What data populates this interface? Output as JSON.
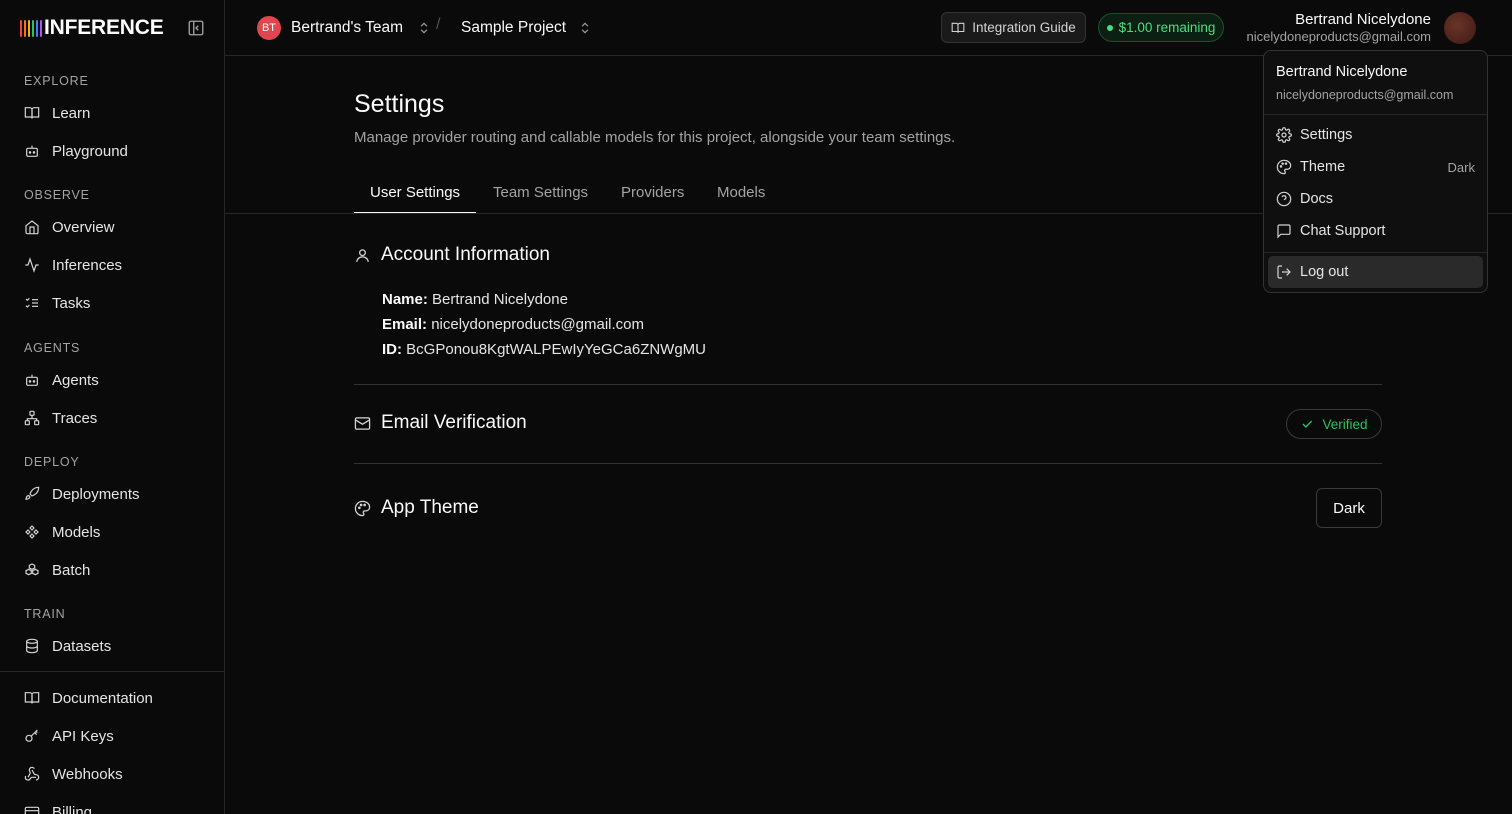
{
  "brand": {
    "name": "INFERENCE",
    "bar_colors": [
      "#ef4444",
      "#f97316",
      "#eab308",
      "#22c55e",
      "#3b82f6",
      "#a855f7"
    ]
  },
  "sidebar": {
    "sections": [
      {
        "label": "EXPLORE",
        "items": [
          {
            "label": "Learn",
            "icon": "book-icon"
          },
          {
            "label": "Playground",
            "icon": "bot-icon"
          }
        ]
      },
      {
        "label": "OBSERVE",
        "items": [
          {
            "label": "Overview",
            "icon": "home-icon"
          },
          {
            "label": "Inferences",
            "icon": "activity-icon"
          },
          {
            "label": "Tasks",
            "icon": "list-checks-icon"
          }
        ]
      },
      {
        "label": "AGENTS",
        "items": [
          {
            "label": "Agents",
            "icon": "bot-icon"
          },
          {
            "label": "Traces",
            "icon": "network-icon"
          }
        ]
      },
      {
        "label": "DEPLOY",
        "items": [
          {
            "label": "Deployments",
            "icon": "rocket-icon"
          },
          {
            "label": "Models",
            "icon": "diamond-nodes-icon"
          },
          {
            "label": "Batch",
            "icon": "boxes-icon"
          }
        ]
      },
      {
        "label": "TRAIN",
        "items": [
          {
            "label": "Datasets",
            "icon": "database-icon"
          }
        ]
      }
    ],
    "footer_items": [
      {
        "label": "Documentation",
        "icon": "book-icon"
      },
      {
        "label": "API Keys",
        "icon": "key-icon"
      },
      {
        "label": "Webhooks",
        "icon": "webhook-icon"
      },
      {
        "label": "Billing",
        "icon": "credit-card-icon"
      }
    ]
  },
  "topbar": {
    "team": {
      "initials": "BT",
      "name": "Bertrand's Team"
    },
    "separator": "/",
    "project": "Sample Project",
    "integration_label": "Integration Guide",
    "credit_label": "$1.00 remaining",
    "user": {
      "name": "Bertrand Nicelydone",
      "email": "nicelydoneproducts@gmail.com"
    }
  },
  "page": {
    "title": "Settings",
    "description": "Manage provider routing and callable models for this project, alongside your team settings.",
    "tabs": [
      "User Settings",
      "Team Settings",
      "Providers",
      "Models"
    ],
    "active_tab": "User Settings"
  },
  "account": {
    "title": "Account Information",
    "name_label": "Name:",
    "name": "Bertrand Nicelydone",
    "email_label": "Email:",
    "email": "nicelydoneproducts@gmail.com",
    "id_label": "ID:",
    "id": "BcGPonou8KgtWALPEwIyYeGCa6ZNWgMU"
  },
  "email_verification": {
    "title": "Email Verification",
    "status": "Verified"
  },
  "app_theme": {
    "title": "App Theme",
    "value": "Dark"
  },
  "dropdown": {
    "name": "Bertrand Nicelydone",
    "email": "nicelydoneproducts@gmail.com",
    "items": [
      {
        "label": "Settings",
        "icon": "gear-icon",
        "right": ""
      },
      {
        "label": "Theme",
        "icon": "palette-icon",
        "right": "Dark"
      },
      {
        "label": "Docs",
        "icon": "help-circle-icon",
        "right": ""
      },
      {
        "label": "Chat Support",
        "icon": "message-square-icon",
        "right": ""
      }
    ],
    "logout": {
      "label": "Log out",
      "icon": "log-out-icon"
    }
  }
}
